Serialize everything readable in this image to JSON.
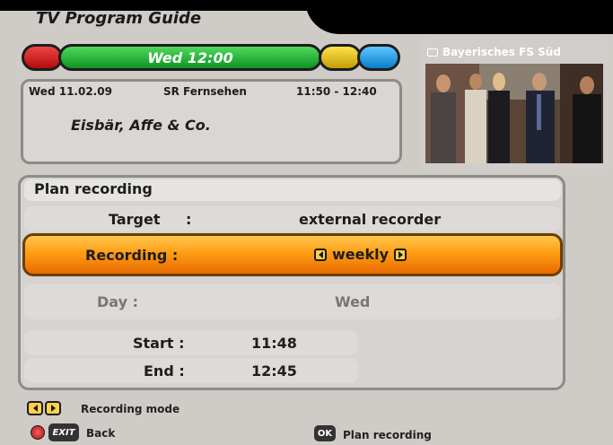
{
  "header": {
    "title": "TV Program Guide"
  },
  "color_bar": {
    "time": "Wed 12:00"
  },
  "program": {
    "date": "Wed 11.02.09",
    "channel": "SR Fernsehen",
    "time_range": "11:50 - 12:40",
    "title": "Eisbär, Affe & Co."
  },
  "preview": {
    "channel": "Bayerisches FS Süd",
    "icon": "tv-icon"
  },
  "plan": {
    "title": "Plan recording",
    "rows": {
      "target": {
        "label": "Target",
        "sep": ":",
        "value": "external recorder"
      },
      "recording": {
        "label": "Recording :",
        "value": "weekly"
      },
      "day": {
        "label": "Day :",
        "value": "Wed"
      },
      "start": {
        "label": "Start :",
        "value": "11:48"
      },
      "end": {
        "label": "End :",
        "value": "12:45"
      }
    }
  },
  "footer": {
    "mode_hint": "Recording mode",
    "exit_key": "EXIT",
    "back": "Back",
    "ok_key": "OK",
    "plan_recording": "Plan recording"
  },
  "colors": {
    "highlight": "#ff9d14",
    "green": "#0f9422",
    "red": "#b40b0b",
    "yellow": "#c39d06",
    "blue": "#0a7ecb"
  }
}
